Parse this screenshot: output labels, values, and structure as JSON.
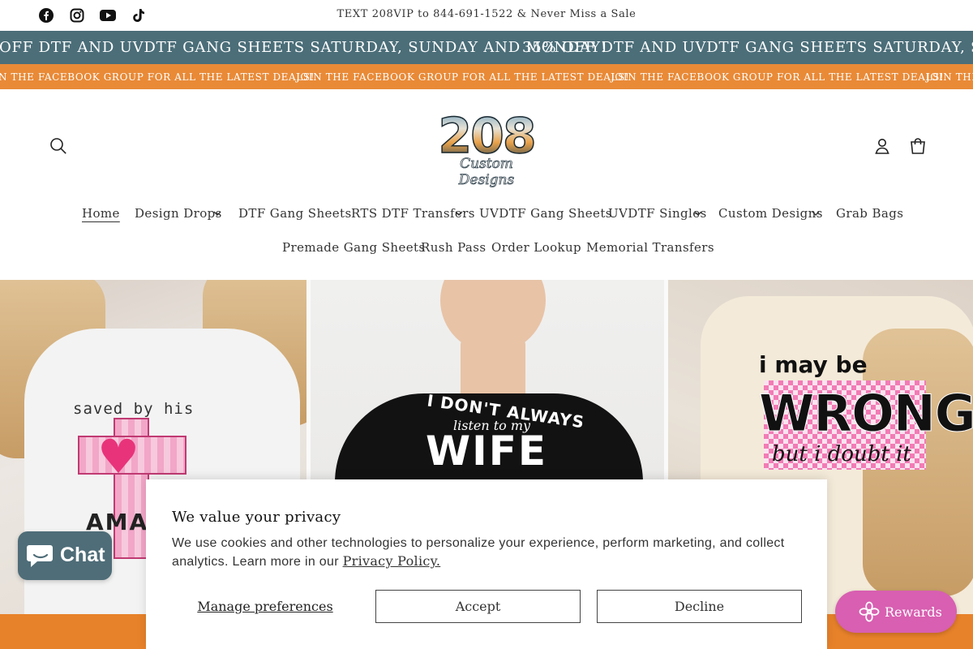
{
  "announcement": {
    "text": "TEXT 208VIP to 844-691-1522 & Never Miss a Sale"
  },
  "social": [
    "facebook-icon",
    "instagram-icon",
    "youtube-icon",
    "tiktok-icon"
  ],
  "marquee_sale": {
    "text_a": "OFF DTF AND UVDTF GANG SHEETS SATURDAY, SUNDAY AND MONDAY!",
    "text_b": "35% OFF DTF AND UVDTF GANG SHEETS SATURDAY, SUNDAY AND"
  },
  "marquee_group": {
    "text_a": "N THE FACEBOOK GROUP FOR ALL THE LATEST DEALS!",
    "text_b": "JOIN THE FACEBOOK GROUP FOR ALL THE LATEST DEALS!",
    "text_c": "JOIN THE FACEBOOK GROUP FOR ALL THE LATEST DEALS!",
    "text_d": "JOIN THE"
  },
  "header": {
    "logo_number": "208",
    "logo_script": "Custom Designs"
  },
  "nav": {
    "row1": [
      "Home",
      "Design Drops",
      "DTF Gang Sheets",
      "RTS DTF Transfers",
      "UVDTF Gang Sheets",
      "UVDTF Singles",
      "Custom Designs",
      "Grab Bags"
    ],
    "row2": [
      "Premade Gang Sheets",
      "Rush Pass",
      "Order Lookup",
      "Memorial Transfers"
    ]
  },
  "hero": {
    "shirt1": {
      "line1": "saved by his",
      "line2": "AMAZ"
    },
    "shirt2": {
      "line1": "I DON'T ALWAYS",
      "line2": "listen to my",
      "line3": "WIFE"
    },
    "shirt3": {
      "line1": "i may be",
      "line2": "WRONG",
      "line3": "but i doubt it"
    }
  },
  "chat": {
    "label": "Chat"
  },
  "cookie": {
    "title": "We value your privacy",
    "body": "We use cookies and other technologies to personalize your experience, perform marketing, and collect analytics. Learn more in our ",
    "link": "Privacy Policy.",
    "manage": "Manage preferences",
    "accept": "Accept",
    "decline": "Decline"
  },
  "rewards": {
    "label": "Rewards"
  },
  "colors": {
    "sale_bar": "#4b6e79",
    "deal_bar": "#e98a37",
    "rewards": "#d85fb1",
    "chat": "#4e6d78"
  }
}
